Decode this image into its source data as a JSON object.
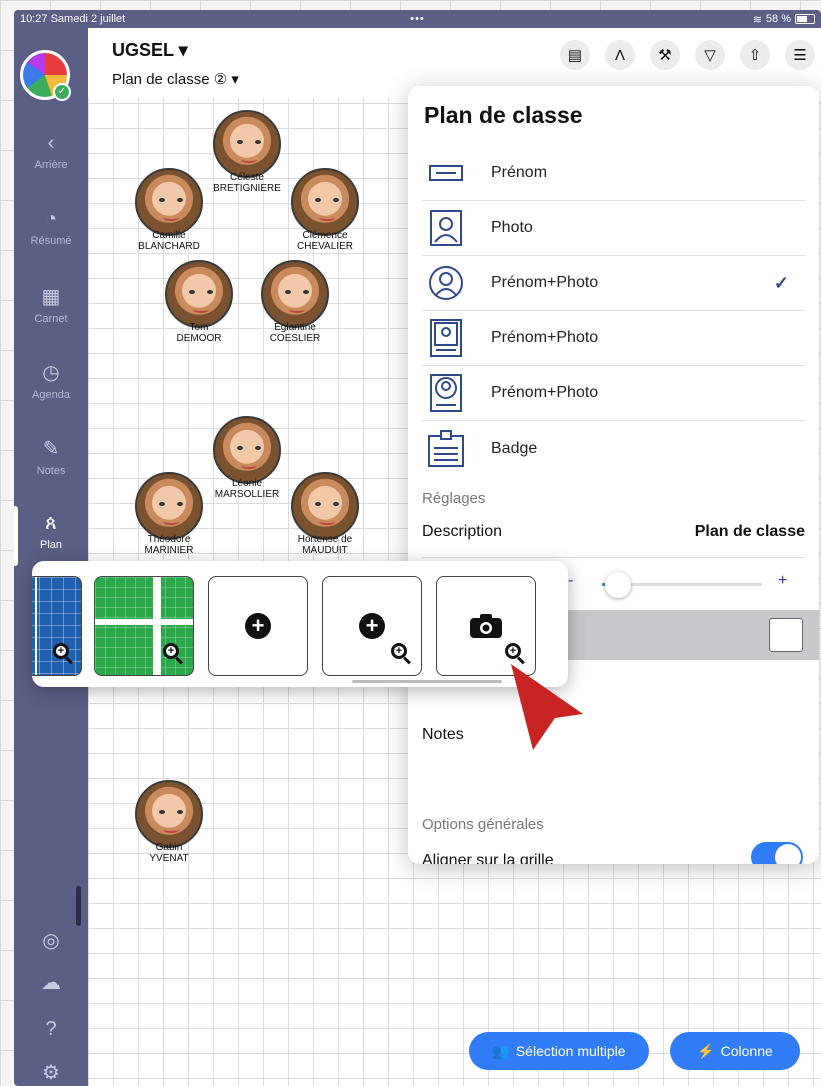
{
  "status": {
    "time": "10:27",
    "date": "Samedi 2 juillet",
    "dots": "•••",
    "battery": "58 %"
  },
  "sidebar": {
    "items": [
      {
        "label": "Arrière",
        "icon": "chevron-left-icon"
      },
      {
        "label": "Résumé",
        "icon": "pie-chart-icon"
      },
      {
        "label": "Carnet",
        "icon": "grid-icon"
      },
      {
        "label": "Agenda",
        "icon": "clock-icon"
      },
      {
        "label": "Notes",
        "icon": "pencil-icon"
      },
      {
        "label": "Plan",
        "icon": "people-icon"
      }
    ]
  },
  "header": {
    "title": "UGSEL ▾",
    "subtitle": "Plan de classe ② ▾"
  },
  "students": [
    {
      "first": "Céleste",
      "last": "BRETIGNIERE"
    },
    {
      "first": "Camille",
      "last": "BLANCHARD"
    },
    {
      "first": "Clémence",
      "last": "CHEVALIER"
    },
    {
      "first": "Tom",
      "last": "DEMOOR"
    },
    {
      "first": "Eglantine",
      "last": "COESLIER"
    },
    {
      "first": "Léonie",
      "last": "MARSOLLIER"
    },
    {
      "first": "Théodore",
      "last": "MARINIER"
    },
    {
      "first": "Hortense de",
      "last": "MAUDUIT"
    },
    {
      "first": "Gabin",
      "last": "YVENAT"
    }
  ],
  "panel": {
    "title": "Plan de classe",
    "options": [
      {
        "label": "Prénom",
        "icon": "name-card-icon",
        "checked": false
      },
      {
        "label": "Photo",
        "icon": "photo-frame-icon",
        "checked": false
      },
      {
        "label": "Prénom+Photo",
        "icon": "round-portrait-icon",
        "checked": true
      },
      {
        "label": "Prénom+Photo",
        "icon": "portrait-name-icon",
        "checked": false
      },
      {
        "label": "Prénom+Photo",
        "icon": "round-portrait-name-icon",
        "checked": false
      },
      {
        "label": "Badge",
        "icon": "badge-icon",
        "checked": false
      }
    ],
    "check": "✓",
    "settings_label": "Réglages",
    "description_label": "Description",
    "description_value": "Plan de classe",
    "slider_minus": "-",
    "slider_plus": "+",
    "slider_level": 0.1,
    "notes_label": "Notes",
    "general_label": "Options générales",
    "grid_label": "Aligner sur la grille",
    "grid_toggle": true
  },
  "bottom": {
    "multi_select": "Sélection multiple",
    "column": "Colonne"
  },
  "colors": {
    "sidebar": "#5b5f86",
    "accent": "#2f7cf6",
    "arrow": "#c82424"
  }
}
